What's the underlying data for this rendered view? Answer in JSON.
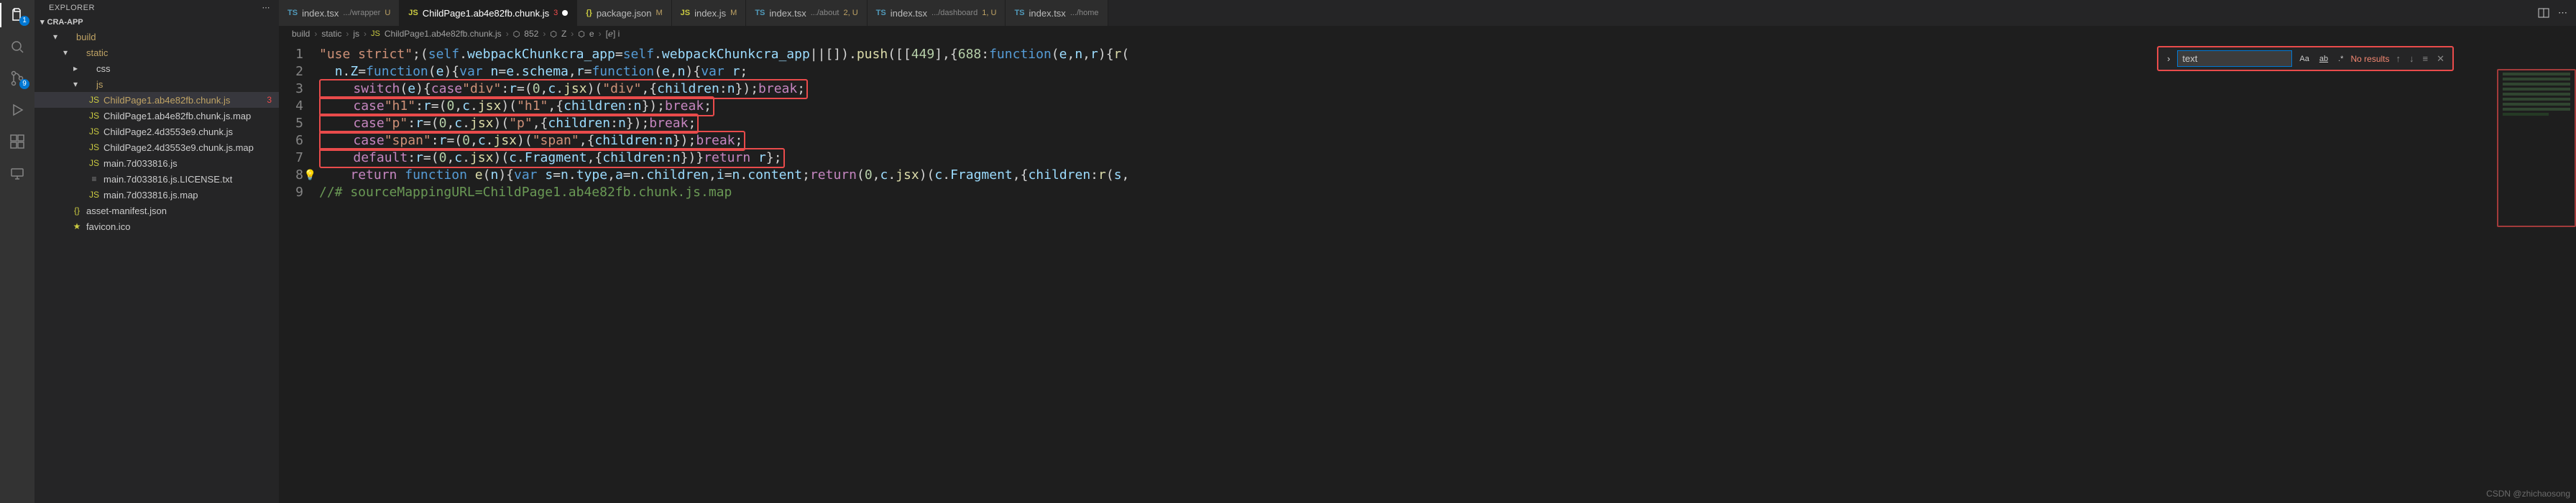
{
  "sidebar": {
    "title": "EXPLORER",
    "root": "CRA-APP",
    "tree": [
      {
        "indent": 22,
        "chev": "▾",
        "icon": "",
        "label": "build",
        "mod": true
      },
      {
        "indent": 36,
        "chev": "▾",
        "icon": "",
        "label": "static",
        "mod": true
      },
      {
        "indent": 50,
        "chev": "▸",
        "icon": "",
        "label": "css"
      },
      {
        "indent": 50,
        "chev": "▾",
        "icon": "",
        "label": "js",
        "mod": true
      },
      {
        "indent": 60,
        "chev": "",
        "icon": "JS",
        "iconColor": "#cbcb41",
        "label": "ChildPage1.ab4e82fb.chunk.js",
        "selected": true,
        "mod": true,
        "tail": "3",
        "err": true
      },
      {
        "indent": 60,
        "chev": "",
        "icon": "JS",
        "iconColor": "#cbcb41",
        "label": "ChildPage1.ab4e82fb.chunk.js.map"
      },
      {
        "indent": 60,
        "chev": "",
        "icon": "JS",
        "iconColor": "#cbcb41",
        "label": "ChildPage2.4d3553e9.chunk.js"
      },
      {
        "indent": 60,
        "chev": "",
        "icon": "JS",
        "iconColor": "#cbcb41",
        "label": "ChildPage2.4d3553e9.chunk.js.map"
      },
      {
        "indent": 60,
        "chev": "",
        "icon": "JS",
        "iconColor": "#cbcb41",
        "label": "main.7d033816.js"
      },
      {
        "indent": 60,
        "chev": "",
        "icon": "≡",
        "iconColor": "#888",
        "label": "main.7d033816.js.LICENSE.txt"
      },
      {
        "indent": 60,
        "chev": "",
        "icon": "JS",
        "iconColor": "#cbcb41",
        "label": "main.7d033816.js.map"
      },
      {
        "indent": 36,
        "chev": "",
        "icon": "{}",
        "iconColor": "#cbcb41",
        "label": "asset-manifest.json"
      },
      {
        "indent": 36,
        "chev": "",
        "icon": "★",
        "iconColor": "#cbcb41",
        "label": "favicon.ico"
      }
    ]
  },
  "tabs": [
    {
      "iconText": "TS",
      "iconColor": "#519aba",
      "name": "index.tsx",
      "suffix": ".../wrapper",
      "status": "U"
    },
    {
      "iconText": "JS",
      "iconColor": "#cbcb41",
      "name": "ChildPage1.ab4e82fb.chunk.js",
      "status": "3",
      "statusColor": "#f14c4c",
      "dirty": true,
      "active": true
    },
    {
      "iconText": "{}",
      "iconColor": "#cbcb41",
      "name": "package.json",
      "status": "M"
    },
    {
      "iconText": "JS",
      "iconColor": "#cbcb41",
      "name": "index.js",
      "status": "M"
    },
    {
      "iconText": "TS",
      "iconColor": "#519aba",
      "name": "index.tsx",
      "suffix": ".../about",
      "status": "2, U"
    },
    {
      "iconText": "TS",
      "iconColor": "#519aba",
      "name": "index.tsx",
      "suffix": ".../dashboard",
      "status": "1, U"
    },
    {
      "iconText": "TS",
      "iconColor": "#519aba",
      "name": "index.tsx",
      "suffix": ".../home"
    }
  ],
  "breadcrumb": [
    "build",
    "static",
    "js",
    "ChildPage1.ab4e82fb.chunk.js",
    "852",
    "Z",
    "e",
    "[ℯ] i"
  ],
  "bcIcons": [
    "",
    "",
    "",
    "JS",
    "⬡",
    "⬡",
    "⬡",
    ""
  ],
  "find": {
    "value": "text",
    "results": "No results"
  },
  "activity_badges": {
    "explorer": "1",
    "scm": "9"
  },
  "code_lines": [
    {
      "n": 1,
      "hl": false,
      "html": "<span class='s1'>\"use strict\"</span><span class='p1'>;(</span><span class='k1'>self</span><span class='p1'>.</span><span class='v1'>webpackChunkcra_app</span><span class='p1'>=</span><span class='k1'>self</span><span class='p1'>.</span><span class='v1'>webpackChunkcra_app</span><span class='p1'>||[]).</span><span class='fn'>push</span><span class='p1'>([[</span><span class='n1'>449</span><span class='p1'>],{</span><span class='n1'>688</span><span class='p1'>:</span><span class='k1'>function</span><span class='p1'>(</span><span class='v1'>e</span><span class='p1'>,</span><span class='v1'>n</span><span class='p1'>,</span><span class='v1'>r</span><span class='p1'>){</span><span class='fn'>r</span><span class='p1'>(</span>"
    },
    {
      "n": 2,
      "hl": false,
      "html": "  <span class='v1'>n</span><span class='p1'>.</span><span class='v1'>Z</span><span class='p1'>=</span><span class='k1'>function</span><span class='p1'>(</span><span class='v1'>e</span><span class='p1'>){</span><span class='k1'>var</span> <span class='v1'>n</span><span class='p1'>=</span><span class='v1'>e</span><span class='p1'>.</span><span class='v1'>schema</span><span class='p1'>,</span><span class='v1'>r</span><span class='p1'>=</span><span class='k1'>function</span><span class='p1'>(</span><span class='v1'>e</span><span class='p1'>,</span><span class='v1'>n</span><span class='p1'>){</span><span class='k1'>var</span> <span class='v1'>r</span><span class='p1'>;</span>"
    },
    {
      "n": 3,
      "hl": true,
      "html": "    <span class='k2'>switch</span><span class='p1'>(</span><span class='v1'>e</span><span class='p1'>){</span><span class='k2'>case</span><span class='s1'>\"div\"</span><span class='p1'>:</span><span class='v1'>r</span><span class='p1'>=(</span><span class='n1'>0</span><span class='p1'>,</span><span class='v1'>c</span><span class='p1'>.</span><span class='fn'>jsx</span><span class='p1'>)(</span><span class='s1'>\"div\"</span><span class='p1'>,{</span><span class='v1'>children</span><span class='p1'>:</span><span class='v1'>n</span><span class='p1'>});</span><span class='k2'>break</span><span class='p1'>;</span>"
    },
    {
      "n": 4,
      "hl": true,
      "html": "    <span class='k2'>case</span><span class='s1'>\"h1\"</span><span class='p1'>:</span><span class='v1'>r</span><span class='p1'>=(</span><span class='n1'>0</span><span class='p1'>,</span><span class='v1'>c</span><span class='p1'>.</span><span class='fn'>jsx</span><span class='p1'>)(</span><span class='s1'>\"h1\"</span><span class='p1'>,{</span><span class='v1'>children</span><span class='p1'>:</span><span class='v1'>n</span><span class='p1'>});</span><span class='k2'>break</span><span class='p1'>;</span>"
    },
    {
      "n": 5,
      "hl": true,
      "html": "    <span class='k2'>case</span><span class='s1'>\"p\"</span><span class='p1'>:</span><span class='v1'>r</span><span class='p1'>=(</span><span class='n1'>0</span><span class='p1'>,</span><span class='v1'>c</span><span class='p1'>.</span><span class='fn'>jsx</span><span class='p1'>)(</span><span class='s1'>\"p\"</span><span class='p1'>,{</span><span class='v1'>children</span><span class='p1'>:</span><span class='v1'>n</span><span class='p1'>});</span><span class='k2'>break</span><span class='p1'>;</span>"
    },
    {
      "n": 6,
      "hl": true,
      "html": "    <span class='k2'>case</span><span class='s1'>\"span\"</span><span class='p1'>:</span><span class='v1'>r</span><span class='p1'>=(</span><span class='n1'>0</span><span class='p1'>,</span><span class='v1'>c</span><span class='p1'>.</span><span class='fn'>jsx</span><span class='p1'>)(</span><span class='s1'>\"span\"</span><span class='p1'>,{</span><span class='v1'>children</span><span class='p1'>:</span><span class='v1'>n</span><span class='p1'>});</span><span class='k2'>break</span><span class='p1'>;</span>"
    },
    {
      "n": 7,
      "hl": true,
      "html": "    <span class='k2'>default</span><span class='p1'>:</span><span class='v1'>r</span><span class='p1'>=(</span><span class='n1'>0</span><span class='p1'>,</span><span class='v1'>c</span><span class='p1'>.</span><span class='fn'>jsx</span><span class='p1'>)(</span><span class='v1'>c</span><span class='p1'>.</span><span class='v1'>Fragment</span><span class='p1'>,{</span><span class='v1'>children</span><span class='p1'>:</span><span class='v1'>n</span><span class='p1'>})}</span><span class='k2'>return</span> <span class='v1'>r</span><span class='p1'>};</span>"
    },
    {
      "n": 8,
      "hl": false,
      "bulb": true,
      "html": "    <span class='k2'>return</span> <span class='k1'>function</span> <span class='fn'>e</span><span class='p1'>(</span><span class='v1'>n</span><span class='p1'>){</span><span class='k1'>var</span> <span class='v1'>s</span><span class='p1'>=</span><span class='v1'>n</span><span class='p1'>.</span><span class='v1'>type</span><span class='p1'>,</span><span class='v1'>a</span><span class='p1'>=</span><span class='v1'>n</span><span class='p1'>.</span><span class='v1'>children</span><span class='p1'>,</span><span class='v1'>i</span><span class='p1'>=</span><span class='v1'>n</span><span class='p1'>.</span><span class='v1'>content</span><span class='p1'>;</span><span class='k2'>return</span><span class='p1'>(</span><span class='n1'>0</span><span class='p1'>,</span><span class='v1'>c</span><span class='p1'>.</span><span class='fn'>jsx</span><span class='p1'>)(</span><span class='v1'>c</span><span class='p1'>.</span><span class='v1'>Fragment</span><span class='p1'>,{</span><span class='v1'>children</span><span class='p1'>:</span><span class='fn'>r</span><span class='p1'>(</span><span class='v1'>s</span><span class='p1'>,</span>"
    },
    {
      "n": 9,
      "hl": false,
      "html": "<span class='cm'>//# sourceMappingURL=ChildPage1.ab4e82fb.chunk.js.map</span>"
    }
  ],
  "watermark": "CSDN @zhichaosong"
}
